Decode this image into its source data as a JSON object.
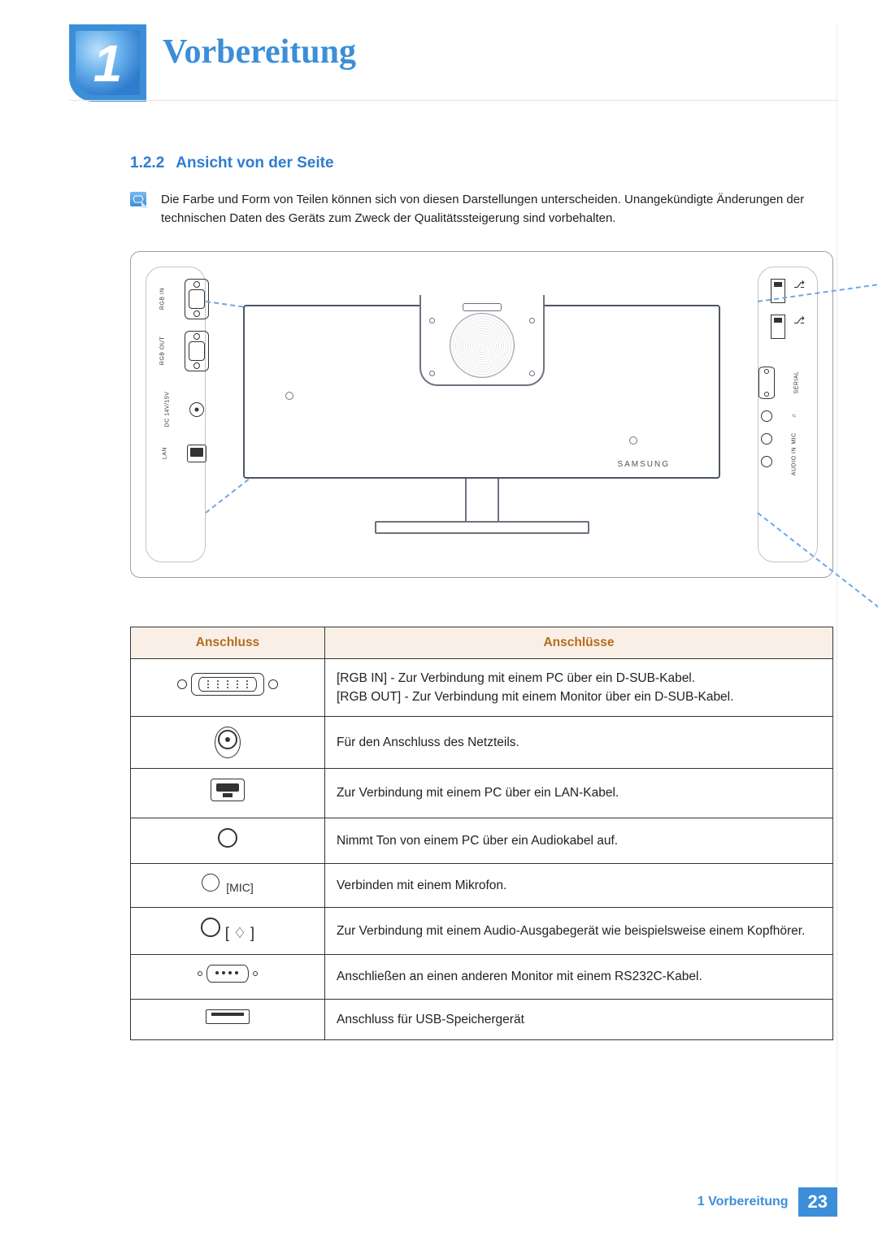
{
  "chapter": {
    "number": "1",
    "title": "Vorbereitung"
  },
  "section": {
    "number": "1.2.2",
    "title": "Ansicht von der Seite"
  },
  "note": "Die Farbe und Form von Teilen können sich von diesen Darstellungen unterscheiden. Unangekündigte Änderungen der technischen Daten des Geräts zum Zweck der Qualitätssteigerung sind vorbehalten.",
  "figure": {
    "brand": "SAMSUNG",
    "left_panel_labels": {
      "rgb_in": "RGB IN",
      "rgb_out": "RGB OUT",
      "dc": "DC 14V/15V",
      "lan": "LAN"
    },
    "right_panel_labels": {
      "serial": "SERIAL",
      "mic": "MIC",
      "audio_in": "AUDIO IN"
    }
  },
  "table": {
    "headers": {
      "port": "Anschluss",
      "ports": "Anschlüsse"
    },
    "rows": [
      {
        "icon": "dsub",
        "label": "",
        "desc": "[RGB IN] - Zur Verbindung mit einem PC über ein D-SUB-Kabel.\n[RGB OUT] - Zur Verbindung mit einem Monitor über ein D-SUB-Kabel."
      },
      {
        "icon": "dc",
        "label": "",
        "desc": "Für den Anschluss des Netzteils."
      },
      {
        "icon": "lan",
        "label": "",
        "desc": "Zur Verbindung mit einem PC über ein LAN-Kabel."
      },
      {
        "icon": "ring",
        "label": "",
        "desc": "Nimmt Ton von einem PC über ein Audiokabel auf."
      },
      {
        "icon": "mic",
        "label": "[MIC]",
        "desc": "Verbinden mit einem Mikrofon."
      },
      {
        "icon": "hp",
        "label": "[ 🎧 ]",
        "desc": "Zur Verbindung mit einem Audio-Ausgabegerät wie beispielsweise einem Kopfhörer."
      },
      {
        "icon": "serial",
        "label": "",
        "desc": "Anschließen an einen anderen Monitor mit einem RS232C-Kabel."
      },
      {
        "icon": "usb",
        "label": "",
        "desc": "Anschluss für USB-Speichergerät"
      }
    ]
  },
  "footer": {
    "label": "1 Vorbereitung",
    "page": "23"
  }
}
